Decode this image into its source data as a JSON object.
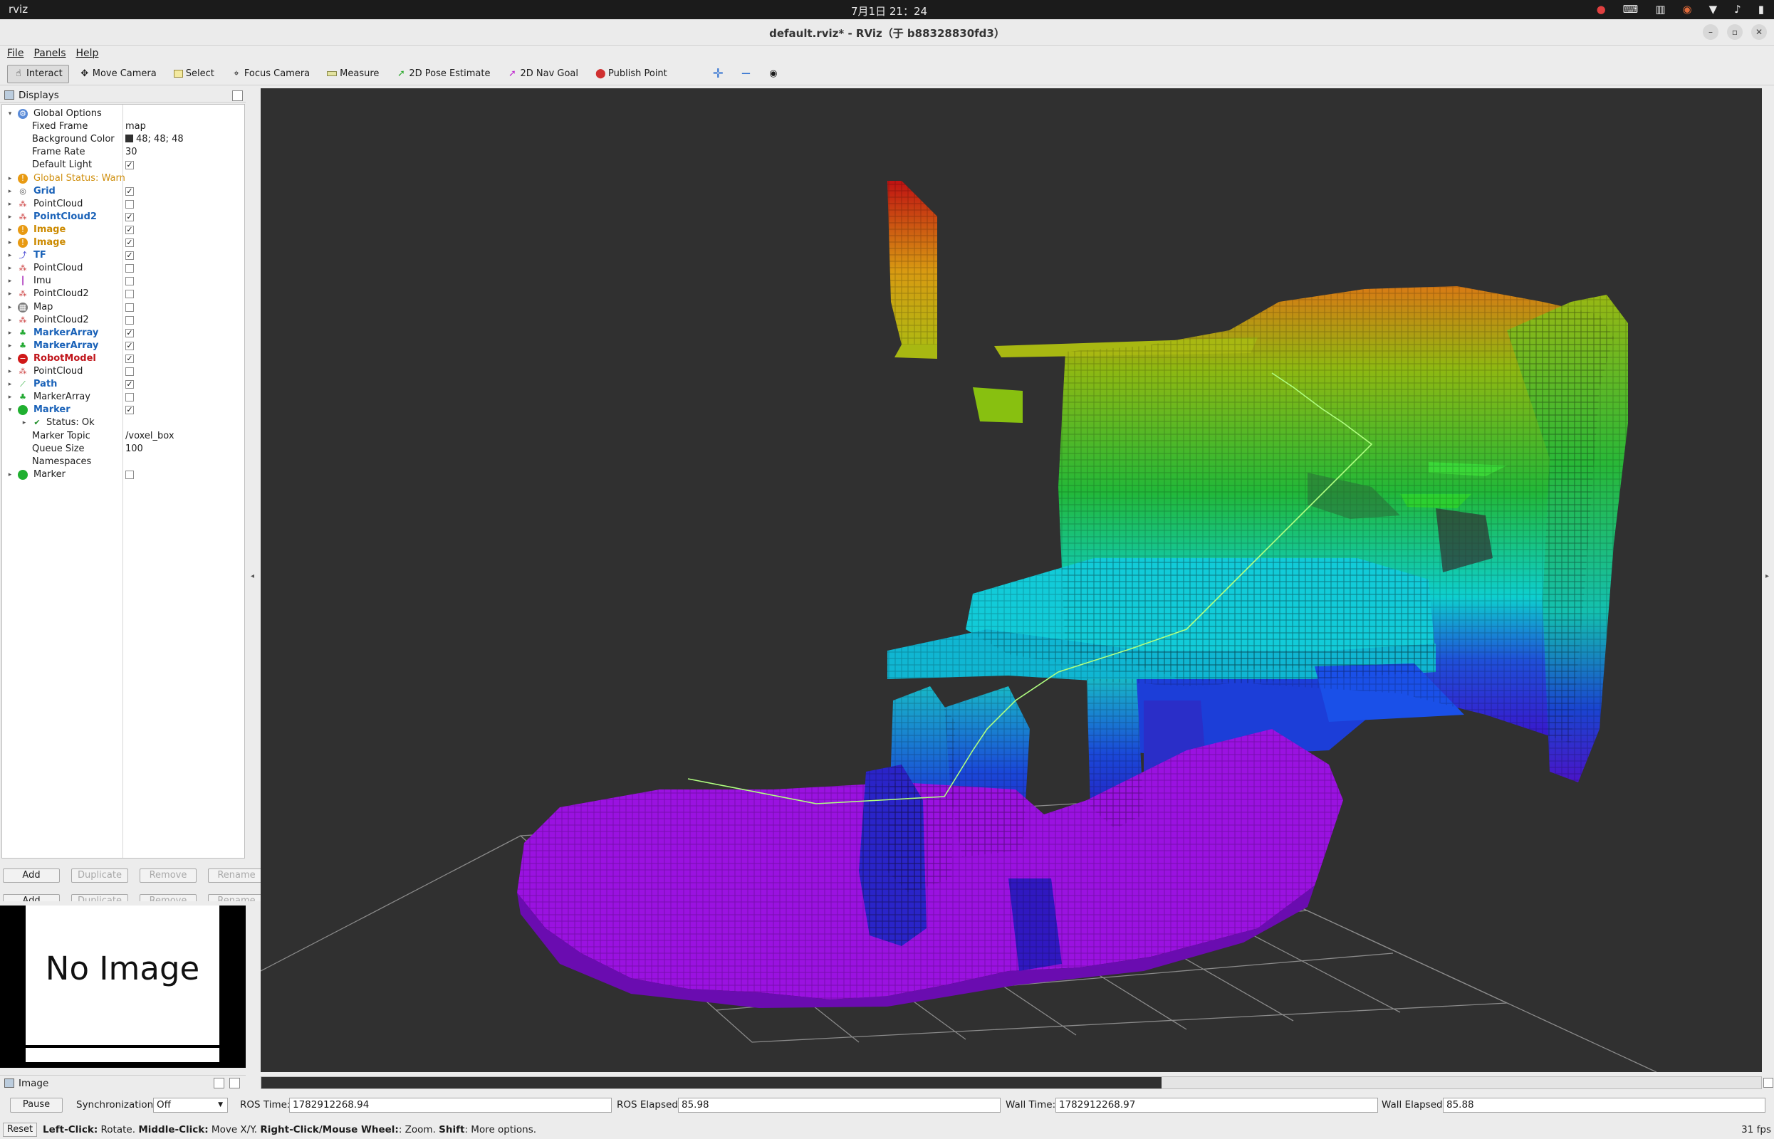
{
  "system_bar": {
    "app_name": "rviz",
    "clock": "7月1日 21：24"
  },
  "window": {
    "title": "default.rviz* - RViz（于 b88328830fd3）"
  },
  "menu": [
    "File",
    "Panels",
    "Help"
  ],
  "toolbar": {
    "tools": [
      "Interact",
      "Move Camera",
      "Select",
      "Focus Camera",
      "Measure",
      "2D Pose Estimate",
      "2D Nav Goal",
      "Publish Point"
    ]
  },
  "displays_panel": {
    "title": "Displays",
    "rows": [
      {
        "label": "Global Options",
        "indent": 0,
        "expanded": true,
        "icon": "gear-icon",
        "style": "normal"
      },
      {
        "label": "Fixed Frame",
        "indent": 1,
        "value": "map"
      },
      {
        "label": "Background Color",
        "indent": 1,
        "value": "48; 48; 48",
        "swatch": "#303030"
      },
      {
        "label": "Frame Rate",
        "indent": 1,
        "value": "30"
      },
      {
        "label": "Default Light",
        "indent": 1,
        "checked": true
      },
      {
        "label": "Global Status: Warn",
        "indent": 0,
        "icon": "warning-icon",
        "style": "orange-plain"
      },
      {
        "label": "Grid",
        "indent": 0,
        "icon": "grid-icon",
        "style": "blue",
        "checked": true
      },
      {
        "label": "PointCloud",
        "indent": 0,
        "icon": "pointcloud-icon",
        "style": "normal",
        "checked": false
      },
      {
        "label": "PointCloud2",
        "indent": 0,
        "icon": "pointcloud-icon",
        "style": "blue",
        "checked": true
      },
      {
        "label": "Image",
        "indent": 0,
        "icon": "warning-icon",
        "style": "orange",
        "checked": true
      },
      {
        "label": "Image",
        "indent": 0,
        "icon": "warning-icon",
        "style": "orange",
        "checked": true
      },
      {
        "label": "TF",
        "indent": 0,
        "icon": "tf-icon",
        "style": "blue",
        "checked": true
      },
      {
        "label": "PointCloud",
        "indent": 0,
        "icon": "pointcloud-icon",
        "style": "normal",
        "checked": false
      },
      {
        "label": "Imu",
        "indent": 0,
        "icon": "imu-icon",
        "style": "normal",
        "checked": false
      },
      {
        "label": "PointCloud2",
        "indent": 0,
        "icon": "pointcloud-icon",
        "style": "normal",
        "checked": false
      },
      {
        "label": "Map",
        "indent": 0,
        "icon": "map-icon",
        "style": "normal",
        "checked": false
      },
      {
        "label": "PointCloud2",
        "indent": 0,
        "icon": "pointcloud-icon",
        "style": "normal",
        "checked": false
      },
      {
        "label": "MarkerArray",
        "indent": 0,
        "icon": "markerarray-icon",
        "style": "blue",
        "checked": true
      },
      {
        "label": "MarkerArray",
        "indent": 0,
        "icon": "markerarray-icon",
        "style": "blue",
        "checked": true
      },
      {
        "label": "RobotModel",
        "indent": 0,
        "icon": "error-icon",
        "style": "red",
        "checked": true
      },
      {
        "label": "PointCloud",
        "indent": 0,
        "icon": "pointcloud-icon",
        "style": "normal",
        "checked": false
      },
      {
        "label": "Path",
        "indent": 0,
        "icon": "path-icon",
        "style": "blue",
        "checked": true
      },
      {
        "label": "MarkerArray",
        "indent": 0,
        "icon": "markerarray-icon",
        "style": "normal",
        "checked": false
      },
      {
        "label": "Marker",
        "indent": 0,
        "expanded": true,
        "icon": "marker-icon",
        "style": "blue",
        "checked": true
      },
      {
        "label": "Status: Ok",
        "indent": 1,
        "icon": "check-icon",
        "style": "normal",
        "collapsed_arrow": true
      },
      {
        "label": "Marker Topic",
        "indent": 1,
        "value": "/voxel_box"
      },
      {
        "label": "Queue Size",
        "indent": 1,
        "value": "100"
      },
      {
        "label": "Namespaces",
        "indent": 1,
        "value": ""
      },
      {
        "label": "Marker",
        "indent": 0,
        "icon": "marker-icon",
        "style": "normal",
        "checked": false
      }
    ],
    "buttons": [
      "Add",
      "Duplicate",
      "Remove",
      "Rename"
    ]
  },
  "image_panel": {
    "title": "Image",
    "placeholder": "No Image"
  },
  "time_bar": {
    "pause_label": "Pause",
    "sync_label": "Synchronization:",
    "sync_value": "Off",
    "ros_time_label": "ROS Time:",
    "ros_time": "1782912268.94",
    "ros_elapsed_label": "ROS Elapsed:",
    "ros_elapsed": "85.98",
    "wall_time_label": "Wall Time:",
    "wall_time": "1782912268.97",
    "wall_elapsed_label": "Wall Elapsed:",
    "wall_elapsed": "85.88"
  },
  "help_bar": {
    "reset_label": "Reset",
    "left_click": "Left-Click:",
    "left_click_desc": " Rotate. ",
    "middle_click": "Middle-Click:",
    "middle_click_desc": " Move X/Y. ",
    "right_click": "Right-Click/Mouse Wheel:",
    "right_click_desc": ": Zoom. ",
    "shift": "Shift",
    "shift_desc": ": More options.",
    "fps": "31 fps"
  },
  "progress": 0.6
}
